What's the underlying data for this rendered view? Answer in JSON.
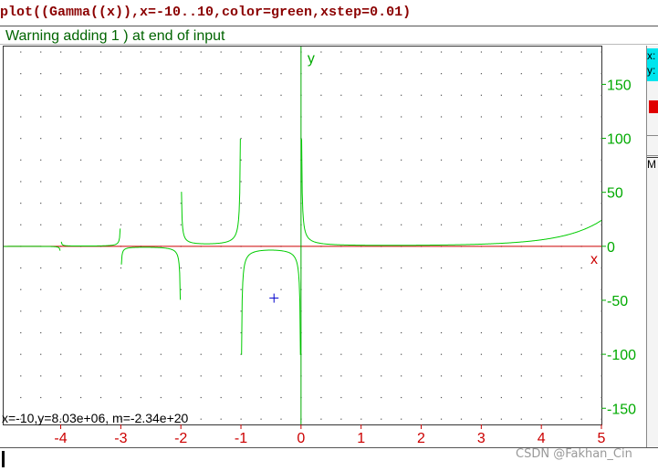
{
  "command": {
    "text": "plot((Gamma((x)),x=-10..10,color=green,xstep=0.01)"
  },
  "warning": "Warning adding 1 ) at end of input",
  "status": "x=-10,y=8.03e+06, m=-2.34e+20",
  "side_panel": {
    "cyan_lines": [
      "x:",
      "y:"
    ],
    "box_label": "M"
  },
  "watermark": "CSDN @Fakhan_Cin",
  "colors": {
    "curve": "#00cc00",
    "x_axis": "#cc0000",
    "y_axis": "#00aa00",
    "cursor": "#0000cc",
    "command": "#8b0000"
  },
  "chart_data": {
    "type": "line",
    "title": "",
    "xlabel": "x",
    "ylabel": "y",
    "xlim": [
      -4.95,
      5.0
    ],
    "ylim": [
      -165,
      185
    ],
    "x_ticks": [
      -4,
      -3,
      -2,
      -1,
      0,
      1,
      2,
      3,
      4,
      5
    ],
    "y_ticks": [
      150,
      100,
      50,
      0,
      -50,
      -100,
      -150
    ],
    "grid": "dotted",
    "cursor_point": [
      -0.45,
      -48
    ],
    "series": [
      {
        "function": "Gamma(x)",
        "x_range": [
          -10,
          10
        ],
        "xstep": 0.01
      }
    ]
  }
}
